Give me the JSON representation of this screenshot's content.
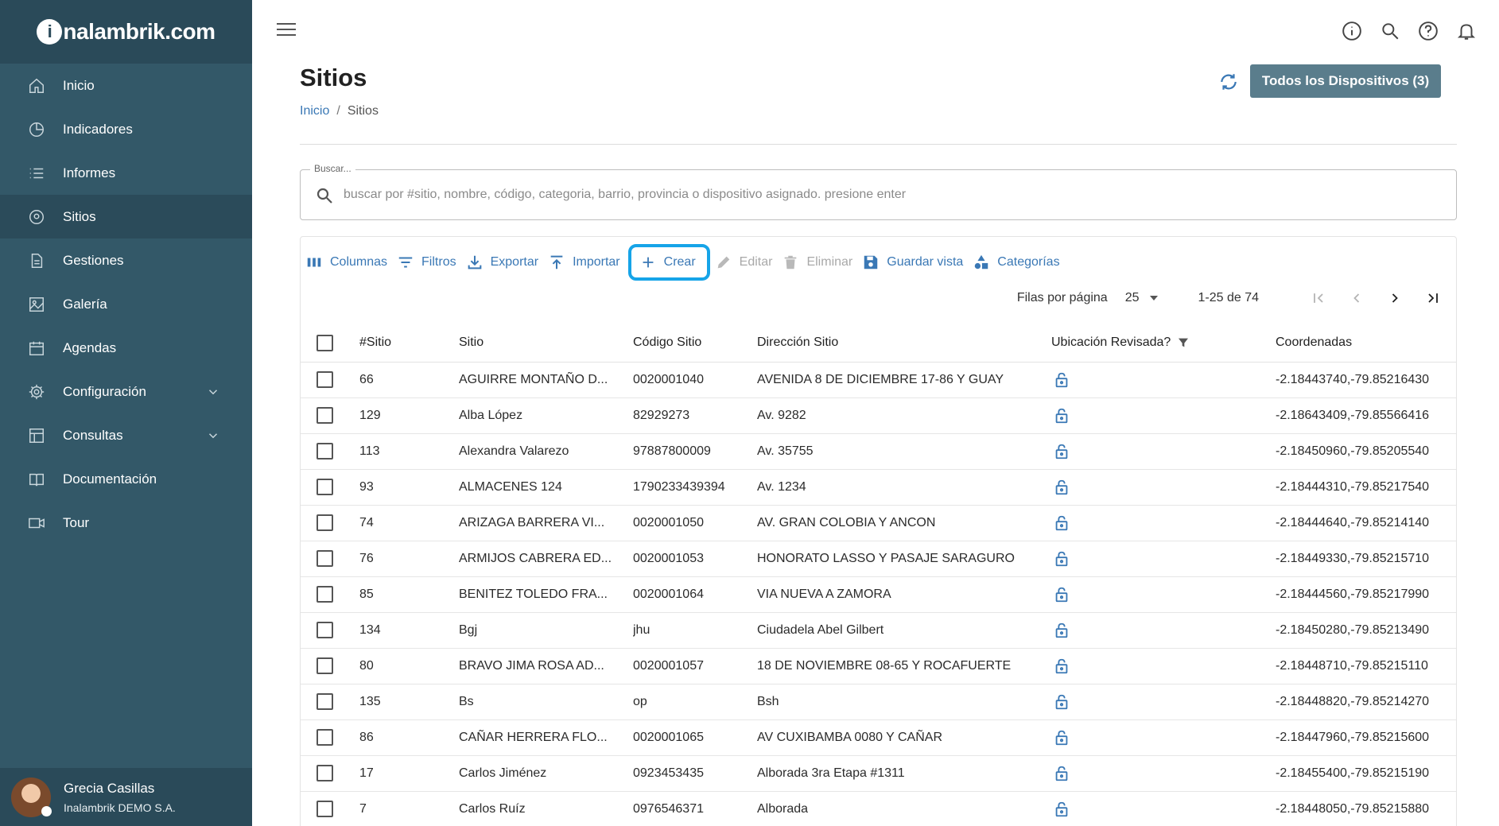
{
  "brand": {
    "logo_mark": "i",
    "logo_text": "nalambrik.com"
  },
  "sidebar": {
    "items": [
      {
        "label": "Inicio",
        "icon": "home-icon",
        "active": false
      },
      {
        "label": "Indicadores",
        "icon": "pie-chart-icon",
        "active": false
      },
      {
        "label": "Informes",
        "icon": "list-icon",
        "active": false
      },
      {
        "label": "Sitios",
        "icon": "location-pin-icon",
        "active": true
      },
      {
        "label": "Gestiones",
        "icon": "document-icon",
        "active": false
      },
      {
        "label": "Galería",
        "icon": "image-icon",
        "active": false
      },
      {
        "label": "Agendas",
        "icon": "calendar-icon",
        "active": false
      },
      {
        "label": "Configuración",
        "icon": "gear-icon",
        "active": false,
        "expandable": true
      },
      {
        "label": "Consultas",
        "icon": "table-icon",
        "active": false,
        "expandable": true
      },
      {
        "label": "Documentación",
        "icon": "book-icon",
        "active": false
      },
      {
        "label": "Tour",
        "icon": "video-icon",
        "active": false
      }
    ],
    "user": {
      "name": "Grecia Casillas",
      "org": "Inalambrik DEMO S.A."
    }
  },
  "header": {
    "title": "Sitios",
    "breadcrumb": [
      "Inicio",
      "Sitios"
    ],
    "breadcrumb_sep": "/",
    "devices_button": "Todos los Dispositivos (3)"
  },
  "search": {
    "label": "Buscar...",
    "placeholder": "buscar por #sitio, nombre, código, categoria, barrio, provincia o dispositivo asignado. presione enter"
  },
  "toolbar": {
    "columns": "Columnas",
    "filters": "Filtros",
    "export": "Exportar",
    "import": "Importar",
    "create": "Crear",
    "edit": "Editar",
    "delete": "Eliminar",
    "save_view": "Guardar vista",
    "categories": "Categorías"
  },
  "pagination": {
    "rows_per_page_label": "Filas por página",
    "rows_per_page": "25",
    "range": "1-25 de 74"
  },
  "table": {
    "headers": {
      "id": "#Sitio",
      "site": "Sitio",
      "code": "Código Sitio",
      "address": "Dirección Sitio",
      "location_checked": "Ubicación Revisada?",
      "coords": "Coordenadas"
    },
    "rows": [
      {
        "id": "66",
        "site": "AGUIRRE MONTAÑO D...",
        "code": "0020001040",
        "address": "AVENIDA 8 DE DICIEMBRE 17-86 Y GUAY",
        "coords": "-2.18443740,-79.85216430"
      },
      {
        "id": "129",
        "site": "Alba López",
        "code": "82929273",
        "address": "Av. 9282",
        "coords": "-2.18643409,-79.85566416"
      },
      {
        "id": "113",
        "site": "Alexandra Valarezo",
        "code": "97887800009",
        "address": "Av. 35755",
        "coords": "-2.18450960,-79.85205540"
      },
      {
        "id": "93",
        "site": "ALMACENES 124",
        "code": "1790233439394",
        "address": "Av. 1234",
        "coords": "-2.18444310,-79.85217540"
      },
      {
        "id": "74",
        "site": "ARIZAGA BARRERA VI...",
        "code": "0020001050",
        "address": "AV. GRAN COLOBIA Y ANCON",
        "coords": "-2.18444640,-79.85214140"
      },
      {
        "id": "76",
        "site": "ARMIJOS CABRERA ED...",
        "code": "0020001053",
        "address": "HONORATO LASSO Y PASAJE SARAGURO",
        "coords": "-2.18449330,-79.85215710"
      },
      {
        "id": "85",
        "site": "BENITEZ TOLEDO FRA...",
        "code": "0020001064",
        "address": "VIA NUEVA A ZAMORA",
        "coords": "-2.18444560,-79.85217990"
      },
      {
        "id": "134",
        "site": "Bgj",
        "code": "jhu",
        "address": "Ciudadela Abel Gilbert",
        "coords": "-2.18450280,-79.85213490"
      },
      {
        "id": "80",
        "site": "BRAVO JIMA ROSA AD...",
        "code": "0020001057",
        "address": "18 DE NOVIEMBRE 08-65 Y ROCAFUERTE",
        "coords": "-2.18448710,-79.85215110"
      },
      {
        "id": "135",
        "site": "Bs",
        "code": "op",
        "address": "Bsh",
        "coords": "-2.18448820,-79.85214270"
      },
      {
        "id": "86",
        "site": "CAÑAR HERRERA FLO...",
        "code": "0020001065",
        "address": "AV CUXIBAMBA 0080 Y CAÑAR",
        "coords": "-2.18447960,-79.85215600"
      },
      {
        "id": "17",
        "site": "Carlos Jiménez",
        "code": "0923453435",
        "address": "Alborada 3ra Etapa #1311",
        "coords": "-2.18455400,-79.85215190"
      },
      {
        "id": "7",
        "site": "Carlos Ruíz",
        "code": "0976546371",
        "address": "Alborada",
        "coords": "-2.18448050,-79.85215880"
      }
    ]
  },
  "colors": {
    "sidebar": "#335868",
    "sidebar_dark": "#2a4a59",
    "accent": "#3a78b5",
    "highlight": "#16a4e8"
  }
}
